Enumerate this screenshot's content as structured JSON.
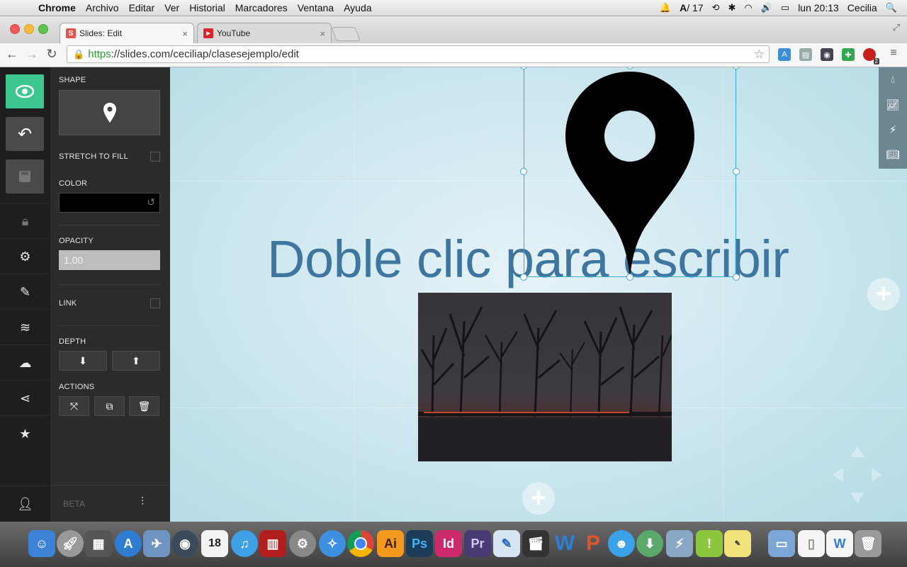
{
  "menubar": {
    "app": "Chrome",
    "menus": [
      "Archivo",
      "Editar",
      "Ver",
      "Historial",
      "Marcadores",
      "Ventana",
      "Ayuda"
    ],
    "status": {
      "adobe_count": "17",
      "clock": "lun 20:13",
      "user": "Cecilia"
    }
  },
  "browser": {
    "tabs": [
      {
        "label": "Slides: Edit",
        "favicon": "S"
      },
      {
        "label": "YouTube",
        "favicon": "▶"
      }
    ],
    "url": {
      "scheme": "https",
      "rest": "://slides.com/ceciliap/clasesejemplo/edit"
    },
    "ext_badge": "2"
  },
  "panel": {
    "shape_label": "SHAPE",
    "stretch_label": "STRETCH TO FILL",
    "color_label": "COLOR",
    "color_value": "#000000",
    "opacity_label": "OPACITY",
    "opacity_value": "1.00",
    "link_label": "LINK",
    "depth_label": "DEPTH",
    "actions_label": "ACTIONS",
    "beta_label": "BETA"
  },
  "canvas": {
    "title_text": "Doble clic para escribir",
    "title_color": "#3f76a0",
    "shape_icon": "map-pin-icon",
    "selection_color": "#3aa9d4"
  },
  "colors": {
    "accent_green": "#3dc88f",
    "panel_bg": "#2b2b2b",
    "rail_bg": "#1e1e1e"
  },
  "dock": {
    "calendar_day": "18",
    "apps": [
      "Finder",
      "Launchpad",
      "Mission Control",
      "App Store",
      "Preview",
      "FaceTime",
      "Calendar",
      "iTunes",
      "Photo Booth",
      "System Preferences",
      "Safari",
      "Chrome",
      "Ai",
      "Ps",
      "Id",
      "Pr",
      "Notes",
      "Final Cut",
      "Word",
      "PowerPoint",
      "Messenger",
      "Downloads",
      "Network",
      "Evernote",
      "Stickies",
      "Folder",
      "Document",
      "Word Doc",
      "Trash"
    ]
  }
}
